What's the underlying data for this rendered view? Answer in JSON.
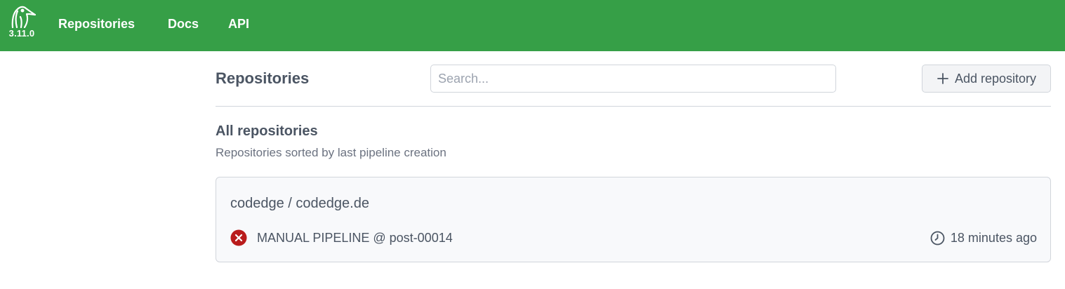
{
  "nav": {
    "version": "3.11.0",
    "links": [
      "Repositories",
      "Docs",
      "API"
    ]
  },
  "header": {
    "title": "Repositories",
    "search_placeholder": "Search...",
    "add_button_label": "Add repository"
  },
  "section": {
    "title": "All repositories",
    "subtitle": "Repositories sorted by last pipeline creation"
  },
  "repos": [
    {
      "name": "codedge / codedge.de",
      "pipeline": "MANUAL PIPELINE @ post-00014",
      "status": "failure",
      "time": "18 minutes ago"
    }
  ],
  "colors": {
    "nav_bg": "#369f47",
    "failure": "#b91c1c"
  },
  "icons": {
    "logo": "woodpecker-logo-icon",
    "add": "plus-icon",
    "status": "error-circle-icon",
    "time": "clock-icon"
  }
}
